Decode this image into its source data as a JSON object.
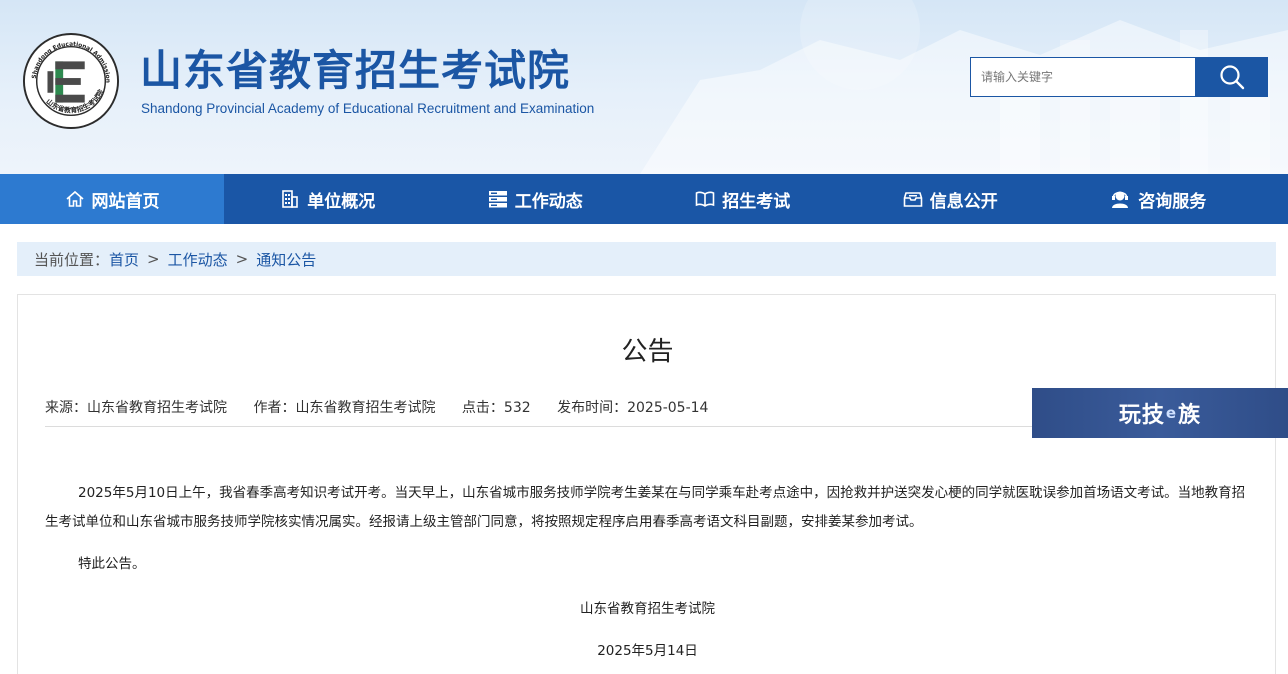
{
  "header": {
    "title_cn": "山东省教育招生考试院",
    "title_en": "Shandong Provincial Academy of Educational Recruitment and Examination",
    "logo_letter": "E",
    "logo_ring_text": "Shandong Educational Admission & Examination",
    "logo_bottom_text": "山东省教育招生考试院",
    "search": {
      "placeholder": "请输入关键字",
      "button_icon": "search-icon"
    }
  },
  "nav": {
    "items": [
      {
        "label": "网站首页",
        "icon": "home-icon",
        "active": true
      },
      {
        "label": "单位概况",
        "icon": "building-icon",
        "active": false
      },
      {
        "label": "工作动态",
        "icon": "server-icon",
        "active": false
      },
      {
        "label": "招生考试",
        "icon": "book-icon",
        "active": false
      },
      {
        "label": "信息公开",
        "icon": "inbox-icon",
        "active": false
      },
      {
        "label": "咨询服务",
        "icon": "support-icon",
        "active": false
      }
    ]
  },
  "breadcrumb": {
    "prefix": "当前位置：",
    "items": [
      "首页",
      "工作动态",
      "通知公告"
    ],
    "separator": ">"
  },
  "article": {
    "title": "公告",
    "meta": {
      "source": "来源：山东省教育招生考试院",
      "author": "作者：山东省教育招生考试院",
      "clicks": "点击：532",
      "publish": "发布时间：2025-05-14"
    },
    "paragraphs": [
      "2025年5月10日上午，我省春季高考知识考试开考。当天早上，山东省城市服务技师学院考生姜某在与同学乘车赴考点途中，因抢救并护送突发心梗的同学就医耽误参加首场语文考试。当地教育招生考试单位和山东省城市服务技师学院核实情况属实。经报请上级主管部门同意，将按照规定程序启用春季高考语文科目副题，安排姜某参加考试。",
      "特此公告。"
    ],
    "signature": "山东省教育招生考试院",
    "date": "2025年5月14日"
  },
  "watermark": {
    "part1": "玩技",
    "part2": "e",
    "part3": "族"
  },
  "colors": {
    "brand": "#1b56a4",
    "nav_bg": "#1a56a6",
    "nav_active": "#2d7ad0",
    "breadcrumb_bg": "#e4effa"
  }
}
